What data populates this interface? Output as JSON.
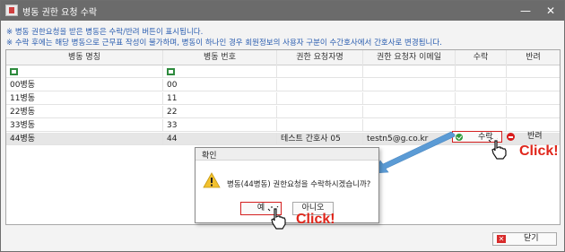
{
  "window": {
    "title": "병동 권한 요청 수락",
    "minimize": "—",
    "close": "✕"
  },
  "notices": [
    "※ 병동 권한요청을 받은 병동은 수락/반려 버튼이 표시됩니다.",
    "※ 수락 후에는 해당 병동으로 근무표 작성이 불가하며, 병동이 하나인 경우 회원정보의 사용자 구분이 수간호사에서 간호사로 변경됩니다."
  ],
  "table": {
    "columns": [
      "병동 명칭",
      "병동 번호",
      "권한 요청자명",
      "권한 요청자 이메일",
      "수락",
      "반려"
    ],
    "rows": [
      [
        "00병동",
        "00",
        "",
        "",
        "",
        ""
      ],
      [
        "11병동",
        "11",
        "",
        "",
        "",
        ""
      ],
      [
        "22병동",
        "22",
        "",
        "",
        "",
        ""
      ],
      [
        "33병동",
        "33",
        "",
        "",
        "",
        ""
      ],
      [
        "44병동",
        "44",
        "테스트 간호사 05",
        "testn5@g.co.kr",
        "수락",
        "반려"
      ]
    ],
    "selected_row": 4
  },
  "annotations": {
    "click_top": "Click!",
    "click_bottom": "Click!"
  },
  "dialog": {
    "title": "확인",
    "message": "병동(44병동) 권한요청을 수락하시겠습니까?",
    "yes_label": "예",
    "no_label": "아니오"
  },
  "footer": {
    "close_label": "닫기"
  },
  "colors": {
    "titlebar": "#6b6b6b",
    "notice_text": "#2a5db0",
    "highlight_border": "#d41f1f",
    "click_text": "#e0261b",
    "arrow": "#5b9bd5"
  }
}
